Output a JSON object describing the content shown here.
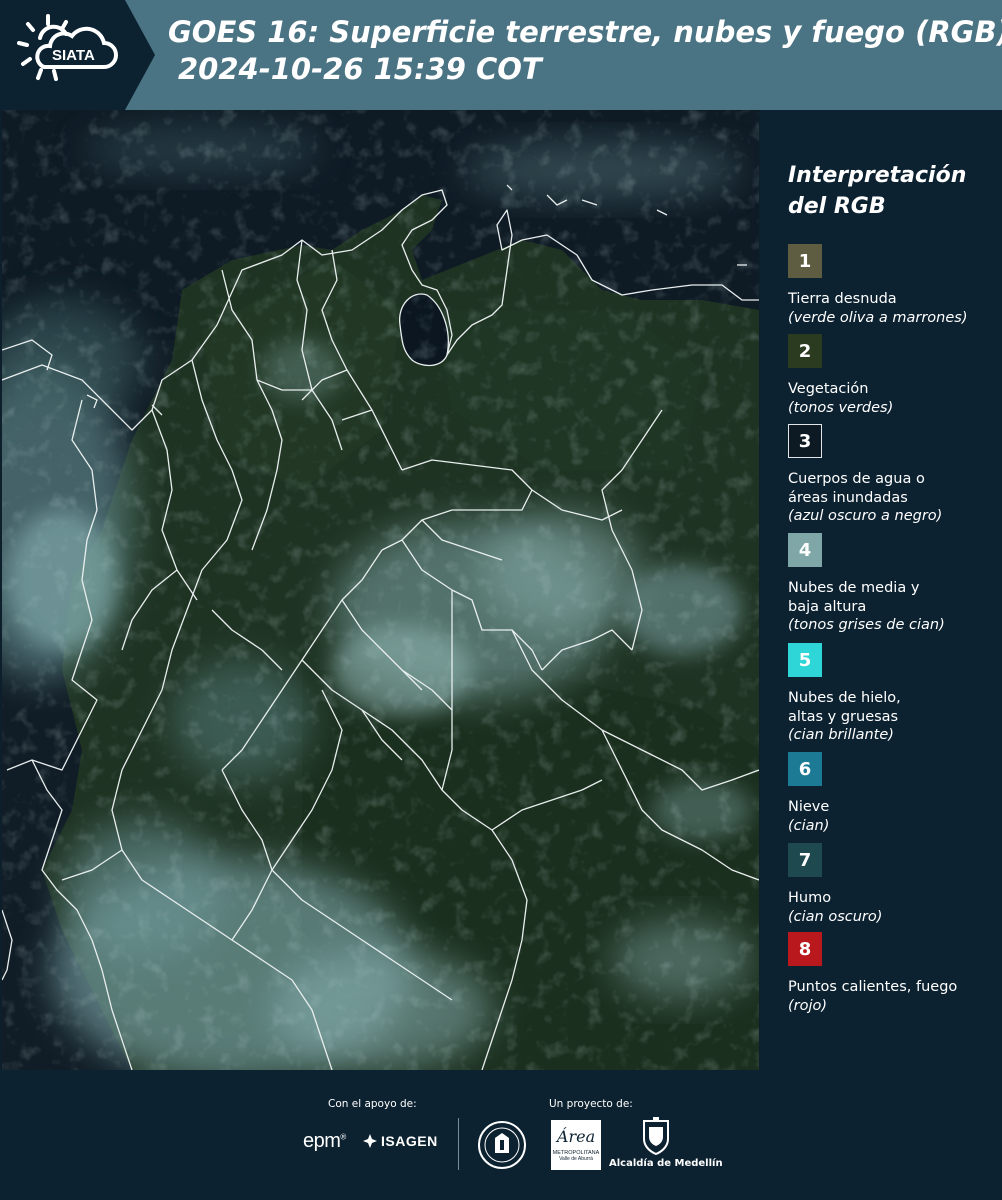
{
  "header": {
    "logo_text": "SIATA",
    "title_line1": "GOES 16: Superficie terrestre, nubes y fuego (RGB)",
    "title_line2": "2024-10-26 15:39 COT"
  },
  "legend": {
    "title": "Interpretación del RGB",
    "items": [
      {
        "num": "1",
        "label": "Tierra desnuda",
        "sub": "(verde oliva a marrones)",
        "color": "#5e5d41",
        "text_color": "#ffffff"
      },
      {
        "num": "2",
        "label": "Vegetación",
        "sub": "(tonos verdes)",
        "color": "#2a3b1f",
        "text_color": "#ffffff"
      },
      {
        "num": "3",
        "label": "Cuerpos de agua o áreas inundadas",
        "sub": "(azul oscuro a negro)",
        "color": "#0d1a24",
        "text_color": "#ffffff"
      },
      {
        "num": "4",
        "label": "Nubes de media y baja altura",
        "sub": "(tonos grises de cian)",
        "color": "#7fa7a7",
        "text_color": "#ffffff"
      },
      {
        "num": "5",
        "label": "Nubes de hielo, altas y gruesas",
        "sub": "(cian brillante)",
        "color": "#2fd6d7",
        "text_color": "#ffffff"
      },
      {
        "num": "6",
        "label": "Nieve",
        "sub": "(cian)",
        "color": "#1d7a95",
        "text_color": "#ffffff"
      },
      {
        "num": "7",
        "label": "Humo",
        "sub": "(cian oscuro)",
        "color": "#1e4a4f",
        "text_color": "#ffffff"
      },
      {
        "num": "8",
        "label": "Puntos calientes, fuego",
        "sub": "(rojo)",
        "color": "#b9181d",
        "text_color": "#ffffff"
      }
    ]
  },
  "footer": {
    "support_label": "Con el apoyo de:",
    "project_label": "Un proyecto de:",
    "epm": "epm",
    "isagen": "ISAGEN",
    "area_metro": "Área",
    "area_metro_sub": "METROPOLITANA",
    "area_metro_sub2": "Valle de Aburrá",
    "alcaldia": "Alcaldía de Medellín"
  }
}
